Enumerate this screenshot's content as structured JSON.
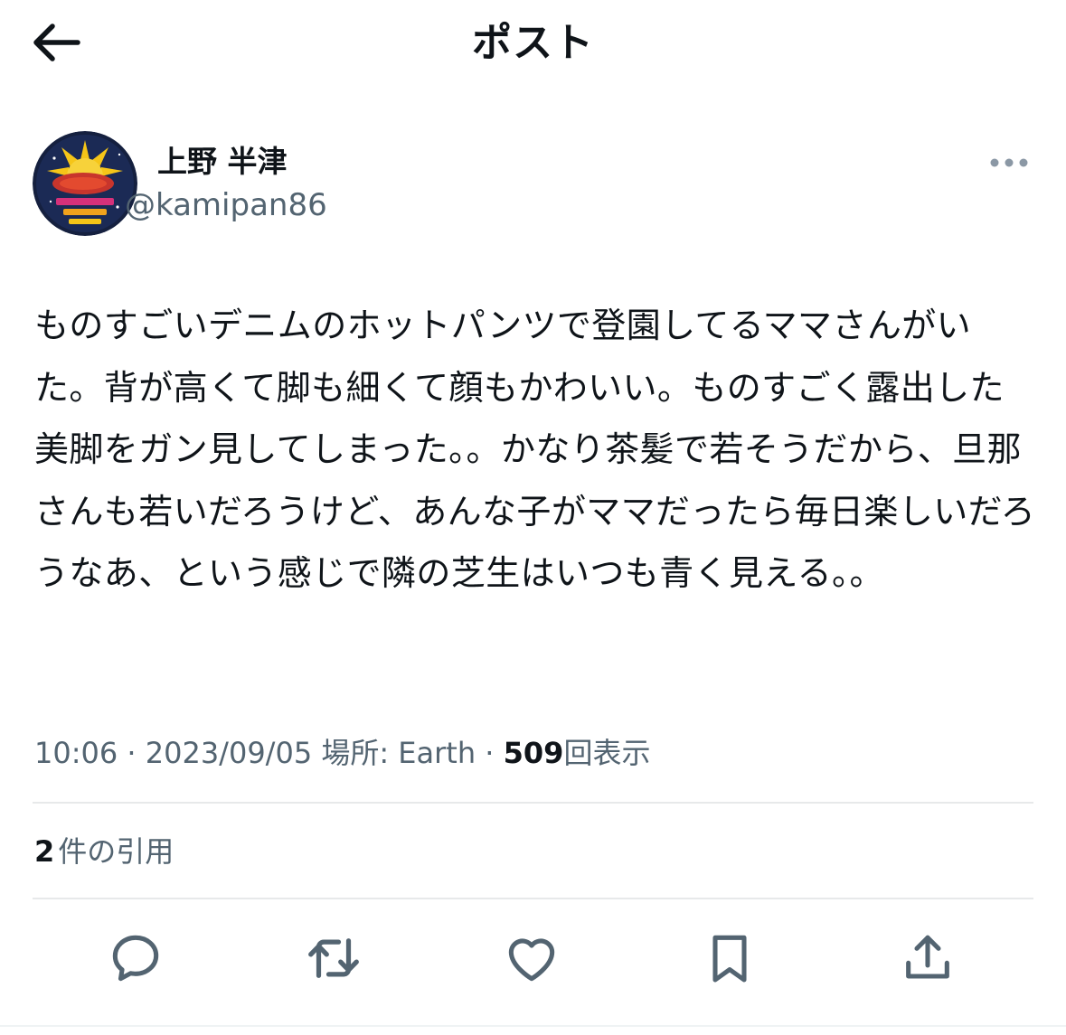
{
  "header": {
    "title": "ポスト",
    "back_icon": "arrow-left-icon"
  },
  "author": {
    "display_name": "上野 半津",
    "handle": "@kamipan86",
    "avatar_icon": "avatar-illustration"
  },
  "tweet": {
    "text": "ものすごいデニムのホットパンツで登園してるママさんがいた。背が高くて脚も細くて顔もかわいい。ものすごく露出した美脚をガン見してしまった。。かなり茶髪で若そうだから、旦那さんも若いだろうけど、あんな子がママだったら毎日楽しいだろうなあ、という感じで隣の芝生はいつも青く見える。。"
  },
  "meta": {
    "time": "10:06",
    "separator": "·",
    "date": "2023/09/05",
    "location": "場所: Earth",
    "views_count": "509",
    "views_label": "回表示"
  },
  "quotes": {
    "count": "2",
    "label": "件の引用"
  },
  "actions": [
    {
      "name": "reply",
      "icon": "reply-icon"
    },
    {
      "name": "retweet",
      "icon": "retweet-icon"
    },
    {
      "name": "like",
      "icon": "heart-icon"
    },
    {
      "name": "bookmark",
      "icon": "bookmark-icon"
    },
    {
      "name": "share",
      "icon": "share-icon"
    }
  ],
  "colors": {
    "text_primary": "#0f1419",
    "text_secondary": "#536471",
    "divider": "#e7e9ea",
    "icon": "#536471"
  }
}
